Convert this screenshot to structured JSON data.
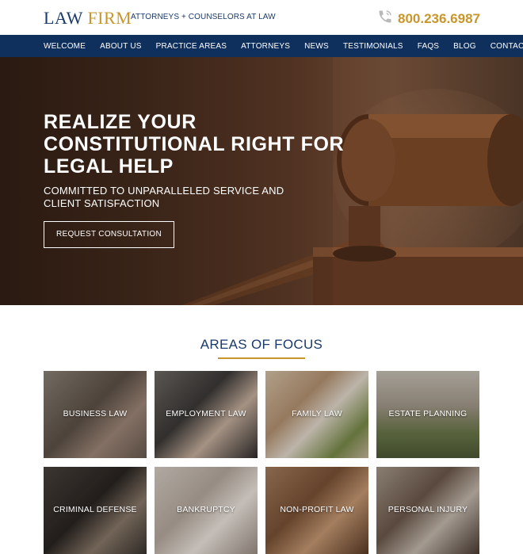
{
  "header": {
    "logo_word1": "LAW",
    "logo_word2": "FIRM",
    "tagline": "ATTORNEYS + COUNSELORS AT LAW",
    "phone": "800.236.6987",
    "phone_icon": "phone-icon",
    "accent_color": "#c9962b",
    "brand_color": "#1a3a6b"
  },
  "nav": {
    "items": [
      {
        "label": "WELCOME"
      },
      {
        "label": "ABOUT US"
      },
      {
        "label": "PRACTICE AREAS"
      },
      {
        "label": "ATTORNEYS"
      },
      {
        "label": "NEWS"
      },
      {
        "label": "TESTIMONIALS"
      },
      {
        "label": "FAQS"
      },
      {
        "label": "BLOG"
      },
      {
        "label": "CONTACT US"
      }
    ]
  },
  "hero": {
    "headline": "REALIZE YOUR CONSTITUTIONAL RIGHT FOR LEGAL HELP",
    "subheadline": "COMMITTED TO UNPARALLELED SERVICE AND CLIENT SATISFACTION",
    "cta_label": "REQUEST CONSULTATION"
  },
  "areas": {
    "title": "AREAS OF FOCUS",
    "tiles": [
      {
        "label": "BUSINESS LAW"
      },
      {
        "label": "EMPLOYMENT LAW"
      },
      {
        "label": "FAMILY LAW"
      },
      {
        "label": "ESTATE PLANNING"
      },
      {
        "label": "CRIMINAL DEFENSE"
      },
      {
        "label": "BANKRUPTCY"
      },
      {
        "label": "NON-PROFIT LAW"
      },
      {
        "label": "PERSONAL INJURY"
      }
    ]
  }
}
